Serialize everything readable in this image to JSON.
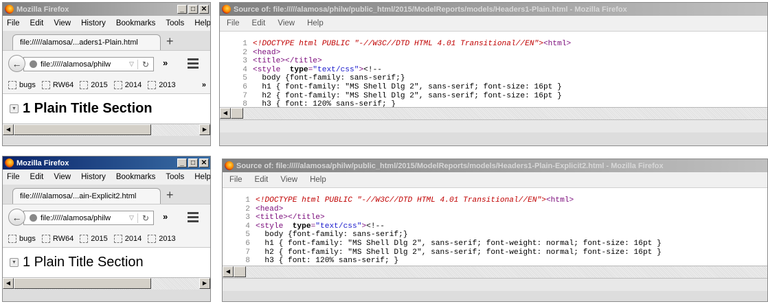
{
  "windows": [
    {
      "title": "Mozilla Firefox",
      "menu": [
        "File",
        "Edit",
        "View",
        "History",
        "Bookmarks",
        "Tools",
        "Help"
      ],
      "tab_label": "file://///alamosa/...aders1-Plain.html",
      "url": "file://///alamosa/philw",
      "bookmarks": [
        "bugs",
        "RW64",
        "2015",
        "2014",
        "2013"
      ],
      "page_heading": "1 Plain Title Section"
    },
    {
      "title": "Mozilla Firefox",
      "menu": [
        "File",
        "Edit",
        "View",
        "History",
        "Bookmarks",
        "Tools",
        "Help"
      ],
      "tab_label": "file://///alamosa/...ain-Explicit2.html",
      "url": "file://///alamosa/philw",
      "bookmarks": [
        "bugs",
        "RW64",
        "2015",
        "2014",
        "2013"
      ],
      "page_heading": "1 Plain Title Section"
    }
  ],
  "source_windows": [
    {
      "title": "Source of: file://///alamosa/philw/public_html/2015/ModelReports/models/Headers1-Plain.html - Mozilla Firefox",
      "menu": [
        "File",
        "Edit",
        "View",
        "Help"
      ],
      "lines": [
        {
          "n": "1",
          "parts": [
            {
              "t": "doctype",
              "s": "<!DOCTYPE html PUBLIC \"-//W3C//DTD HTML 4.01 Transitional//EN\">"
            },
            {
              "t": "tag",
              "s": "<html>"
            }
          ]
        },
        {
          "n": "2",
          "parts": [
            {
              "t": "tag",
              "s": "<head>"
            }
          ]
        },
        {
          "n": "3",
          "parts": [
            {
              "t": "tag",
              "s": "<title></title>"
            }
          ]
        },
        {
          "n": "4",
          "parts": [
            {
              "t": "tag",
              "s": "<style  "
            },
            {
              "t": "attr",
              "s": "type"
            },
            {
              "t": "tag",
              "s": "="
            },
            {
              "t": "val",
              "s": "\"text/css\""
            },
            {
              "t": "tag",
              "s": ">"
            },
            {
              "t": "plain",
              "s": "<!--"
            }
          ]
        },
        {
          "n": "5",
          "parts": [
            {
              "t": "plain",
              "s": "  body {font-family: sans-serif;}"
            }
          ]
        },
        {
          "n": "6",
          "parts": [
            {
              "t": "plain",
              "s": "  h1 { font-family: \"MS Shell Dlg 2\", sans-serif; font-size: 16pt }"
            }
          ]
        },
        {
          "n": "7",
          "parts": [
            {
              "t": "plain",
              "s": "  h2 { font-family: \"MS Shell Dlg 2\", sans-serif; font-size: 16pt }"
            }
          ]
        },
        {
          "n": "8",
          "parts": [
            {
              "t": "plain",
              "s": "  h3 { font: 120% sans-serif; }"
            }
          ]
        }
      ]
    },
    {
      "title": "Source of: file://///alamosa/philw/public_html/2015/ModelReports/models/Headers1-Plain-Explicit2.html - Mozilla Firefox",
      "menu": [
        "File",
        "Edit",
        "View",
        "Help"
      ],
      "lines": [
        {
          "n": "1",
          "parts": [
            {
              "t": "doctype",
              "s": "<!DOCTYPE html PUBLIC \"-//W3C//DTD HTML 4.01 Transitional//EN\">"
            },
            {
              "t": "tag",
              "s": "<html>"
            }
          ]
        },
        {
          "n": "2",
          "parts": [
            {
              "t": "tag",
              "s": "<head>"
            }
          ]
        },
        {
          "n": "3",
          "parts": [
            {
              "t": "tag",
              "s": "<title></title>"
            }
          ]
        },
        {
          "n": "4",
          "parts": [
            {
              "t": "tag",
              "s": "<style  "
            },
            {
              "t": "attr",
              "s": "type"
            },
            {
              "t": "tag",
              "s": "="
            },
            {
              "t": "val",
              "s": "\"text/css\""
            },
            {
              "t": "tag",
              "s": ">"
            },
            {
              "t": "plain",
              "s": "<!--"
            }
          ]
        },
        {
          "n": "5",
          "parts": [
            {
              "t": "plain",
              "s": "  body {font-family: sans-serif;}"
            }
          ]
        },
        {
          "n": "6",
          "parts": [
            {
              "t": "plain",
              "s": "  h1 { font-family: \"MS Shell Dlg 2\", sans-serif; font-weight: normal; font-size: 16pt }"
            }
          ]
        },
        {
          "n": "7",
          "parts": [
            {
              "t": "plain",
              "s": "  h2 { font-family: \"MS Shell Dlg 2\", sans-serif; font-weight: normal; font-size: 16pt }"
            }
          ]
        },
        {
          "n": "8",
          "parts": [
            {
              "t": "plain",
              "s": "  h3 { font: 120% sans-serif; }"
            }
          ]
        }
      ]
    }
  ]
}
